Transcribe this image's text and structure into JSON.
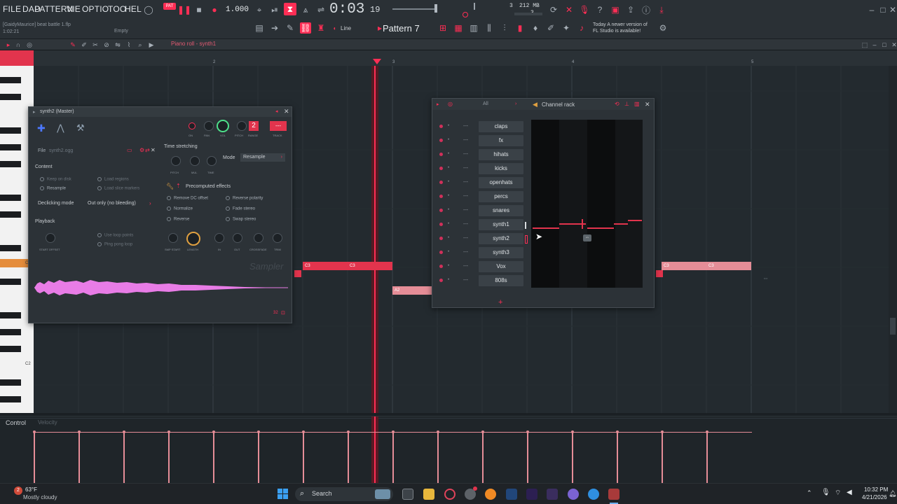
{
  "menu": [
    "FILE",
    "DAD",
    "PATTERN",
    "VIE",
    "OPTIO",
    "TOO",
    "HEL"
  ],
  "project": {
    "file": "[GaidyMaurice] beat battle 1.flp",
    "time": "1:02:21",
    "empty": "Empty"
  },
  "transport": {
    "tempo": "1.000",
    "clock": "0:03",
    "clock_frames": "19",
    "cpu": "3",
    "mem": "212 MB",
    "mem_sub": "3",
    "lines": "Line"
  },
  "pattern": {
    "label": "Pattern 7"
  },
  "news": {
    "line1": "Today  A newer version of",
    "line2": "FL Studio is available!"
  },
  "pianoroll": {
    "title": "Piano roll - synth1",
    "bars": [
      "2",
      "3",
      "4",
      "5"
    ],
    "key_labels": [
      "C3",
      "C2"
    ]
  },
  "notes": [
    {
      "label": "C3"
    },
    {
      "label": "C3"
    },
    {
      "label": "A2"
    },
    {
      "label": "C3"
    },
    {
      "label": "C3"
    }
  ],
  "control": {
    "label": "Control",
    "param": "Velocity"
  },
  "sampler": {
    "title": "synth2 (Master)",
    "file_label": "File",
    "file_name": "synth2.ogg",
    "knob_labels": [
      "ON",
      "PAN",
      "VOL",
      "PITCH",
      "RANGE",
      "TRACK"
    ],
    "range_value": "2",
    "time_stretching": "Time stretching",
    "mode_label": "Mode",
    "mode_value": "Resample",
    "ts_knobs": [
      "PITCH",
      "MUL",
      "TIME"
    ],
    "content": "Content",
    "keep_on_disk": "Keep on disk",
    "resample": "Resample",
    "load_regions": "Load regions",
    "load_slice": "Load slice markers",
    "declicking_label": "Declicking mode",
    "declicking_value": "Out only (no bleeding)",
    "precomputed": "Precomputed effects",
    "effects": [
      "Remove DC offset",
      "Normalize",
      "Reverse",
      "Reverse polarity",
      "Fade stereo",
      "Swap stereo"
    ],
    "playback": "Playback",
    "start_offset": "START OFFSET",
    "use_loop": "Use loop points",
    "ping_pong": "Ping pong loop",
    "bottom_knobs": [
      "SMP START",
      "LENGTH",
      "IN",
      "OUT",
      "CROSSFADE",
      "TRIM"
    ],
    "brand": "Sampler",
    "footer": "32"
  },
  "rack": {
    "title": "Channel rack",
    "filter": "All",
    "channels": [
      "claps",
      "fx",
      "hihats",
      "kicks",
      "openhats",
      "percs",
      "snares",
      "synth1",
      "synth2",
      "synth3",
      "Vox",
      "808s"
    ],
    "add": "+"
  },
  "taskbar": {
    "temp": "63°F",
    "weather": "Mostly cloudy",
    "search": "Search",
    "time": "10:32 PM",
    "date": "4/21/2026"
  },
  "colors": {
    "accent": "#ff2e55",
    "note": "#e2344d",
    "note_ghost": "#e58d97",
    "bg": "#1b2024"
  }
}
